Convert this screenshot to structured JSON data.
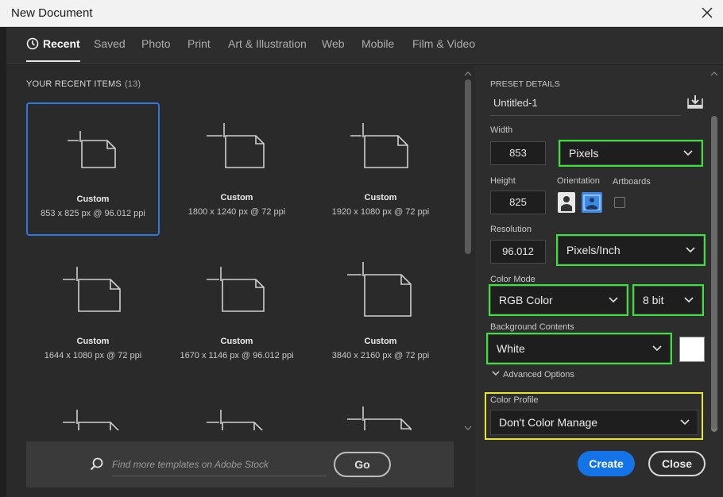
{
  "window": {
    "title": "New Document"
  },
  "tabs": [
    {
      "label": "Recent"
    },
    {
      "label": "Saved"
    },
    {
      "label": "Photo"
    },
    {
      "label": "Print"
    },
    {
      "label": "Art & Illustration"
    },
    {
      "label": "Web"
    },
    {
      "label": "Mobile"
    },
    {
      "label": "Film & Video"
    }
  ],
  "recent": {
    "heading": "YOUR RECENT ITEMS",
    "count": "(13)",
    "items": [
      {
        "name": "Custom",
        "dims": "853 x 825 px @ 96.012 ppi"
      },
      {
        "name": "Custom",
        "dims": "1800 x 1240 px @ 72 ppi"
      },
      {
        "name": "Custom",
        "dims": "1920 x 1080 px @ 72 ppi"
      },
      {
        "name": "Custom",
        "dims": "1644 x 1080 px @ 72 ppi"
      },
      {
        "name": "Custom",
        "dims": "1670 x 1146 px @ 96.012 ppi"
      },
      {
        "name": "Custom",
        "dims": "3840 x 2160 px @ 72 ppi"
      }
    ]
  },
  "search": {
    "placeholder": "Find more templates on Adobe Stock",
    "go_label": "Go"
  },
  "preset": {
    "heading": "PRESET DETAILS",
    "name": "Untitled-1",
    "width_label": "Width",
    "width": "853",
    "width_unit": "Pixels",
    "height_label": "Height",
    "height": "825",
    "orientation_label": "Orientation",
    "artboards_label": "Artboards",
    "resolution_label": "Resolution",
    "resolution": "96.012",
    "resolution_unit": "Pixels/Inch",
    "color_mode_label": "Color Mode",
    "color_mode": "RGB Color",
    "bit_depth": "8 bit",
    "background_label": "Background Contents",
    "background": "White",
    "advanced_label": "Advanced Options",
    "color_profile_label": "Color Profile",
    "color_profile": "Don't Color Manage"
  },
  "actions": {
    "create_label": "Create",
    "close_label": "Close"
  },
  "colors": {
    "accent": "#1473e6",
    "highlight_green": "#39e339",
    "highlight_yellow": "#e6e632",
    "selection": "#2b79e0"
  }
}
